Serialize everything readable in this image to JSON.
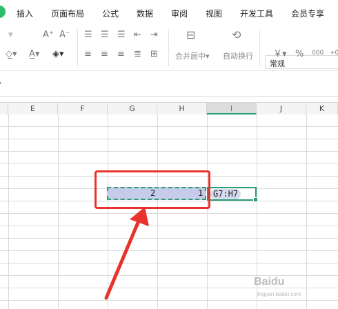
{
  "menubar": {
    "items": [
      "插入",
      "页面布局",
      "公式",
      "数据",
      "审阅",
      "视图",
      "开发工具",
      "会员专享"
    ]
  },
  "toolbar": {
    "merge_label": "合并居中",
    "wrap_label": "自动换行",
    "font_name": "常规",
    "currency_symbol": "￥",
    "percent_symbol": "%",
    "font_grow": "A⁺",
    "font_shrink": "A⁻"
  },
  "columns": [
    "E",
    "F",
    "G",
    "H",
    "I",
    "J",
    "K"
  ],
  "active_column": "I",
  "cells": {
    "g7_value": "2",
    "h7_value": "1",
    "i7_colon": ":",
    "i7_formula": "G7:H7"
  },
  "watermark": {
    "brand": "Baidu",
    "sub": "jingyan.baidu.com"
  },
  "colors": {
    "accent": "#2a9d75",
    "selection": "#c5cbe9",
    "annotation_red": "#e8322c"
  }
}
